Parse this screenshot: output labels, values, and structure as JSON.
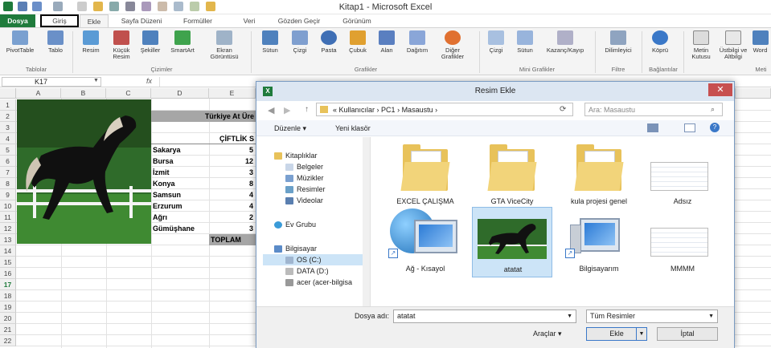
{
  "window": {
    "title": "Kitap1 - Microsoft Excel"
  },
  "tabs": [
    "Dosya",
    "Giriş",
    "Ekle",
    "Sayfa Düzeni",
    "Formüller",
    "Veri",
    "Gözden Geçir",
    "Görünüm"
  ],
  "ribbon": {
    "buttons": [
      "PivotTable",
      "Tablo",
      "Resim",
      "Küçük Resim",
      "Şekiller",
      "SmartArt",
      "Ekran Görüntüsü",
      "Sütun",
      "Çizgi",
      "Pasta",
      "Çubuk",
      "Alan",
      "Dağıtım",
      "Diğer Grafikler",
      "Çizgi",
      "Sütun",
      "Kazanç/Kayıp",
      "Dilimleyici",
      "Köprü",
      "Metin Kutusu",
      "Üstbilgi ve Altbilgi",
      "Word"
    ],
    "groups": [
      "Tablolar",
      "Çizimler",
      "Grafikler",
      "Mini Grafikler",
      "Filtre",
      "Bağlantılar",
      "Meti"
    ]
  },
  "formula_bar": {
    "name_box": "K17",
    "fx": "fx"
  },
  "columns": [
    "A",
    "B",
    "C",
    "D",
    "E"
  ],
  "rows": [
    "1",
    "2",
    "3",
    "4",
    "5",
    "6",
    "7",
    "8",
    "9",
    "10",
    "11",
    "12",
    "13",
    "14",
    "15",
    "16",
    "17",
    "18",
    "19",
    "20",
    "21",
    "22"
  ],
  "sheet": {
    "title": "Türkiye At Üre",
    "subtitle": "ÇİFTLİK S",
    "cities": [
      "Sakarya",
      "Bursa",
      "İzmit",
      "Konya",
      "Samsun",
      "Erzurum",
      "Ağrı",
      "Gümüşhane"
    ],
    "values": [
      "5",
      "12",
      "3",
      "8",
      "4",
      "4",
      "2",
      "3"
    ],
    "total": "TOPLAM"
  },
  "dialog": {
    "title": "Resim Ekle",
    "breadcrumb": [
      "Kullanıcılar",
      "PC1",
      "Masaustu"
    ],
    "search_placeholder": "Ara: Masaustu",
    "organize": "Düzenle",
    "new_folder": "Yeni klasör",
    "nav": {
      "libraries": "Kitaplıklar",
      "library_items": [
        "Belgeler",
        "Müzikler",
        "Resimler",
        "Videolar"
      ],
      "homegroup": "Ev Grubu",
      "computer": "Bilgisayar",
      "drives": [
        "OS (C:)",
        "DATA (D:)",
        "acer (acer-bilgisa"
      ]
    },
    "files": [
      "EXCEL ÇALIŞMA",
      "GTA ViceCity",
      "kula projesi genel",
      "Adsız",
      "Ağ - Kısayol",
      "atatat",
      "Bilgisayarım",
      "MMMM"
    ],
    "filename_label": "Dosya adı:",
    "filename_value": "atatat",
    "filetype_value": "Tüm Resimler",
    "tools": "Araçlar",
    "insert_button": "Ekle",
    "cancel_button": "İptal"
  },
  "colors": {
    "excel_green": "#1f7b3c",
    "dialog_title": "#dce6f2",
    "selection": "#cce4f7"
  }
}
